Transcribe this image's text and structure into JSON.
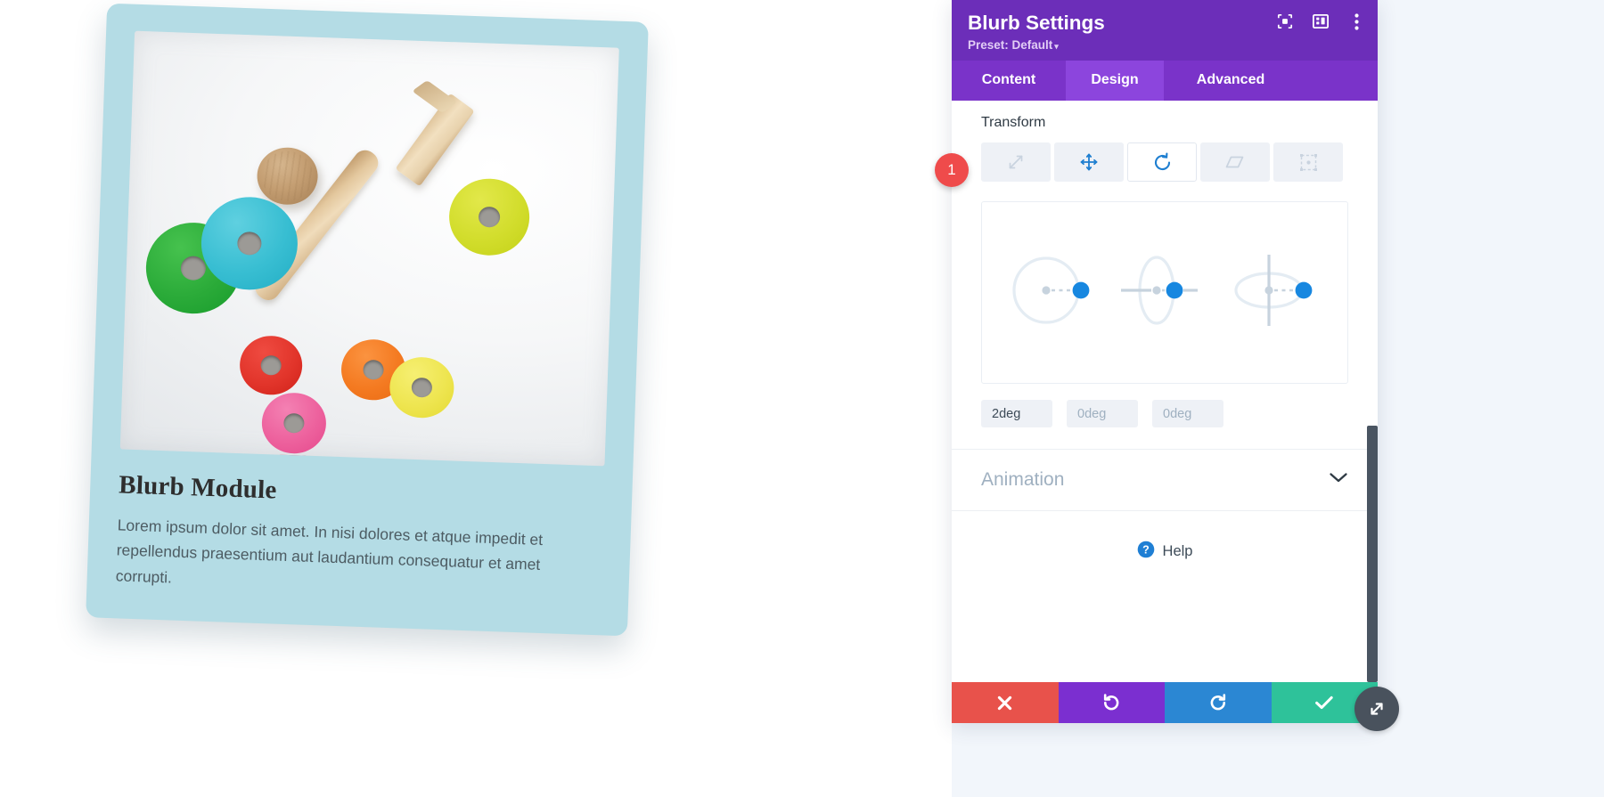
{
  "canvas": {
    "module": {
      "title": "Blurb Module",
      "description": "Lorem ipsum dolor sit amet. In nisi dolores et atque impedit et repellendus praesentium aut laudantium consequatur et amet corrupti.",
      "card_background": "#b4dce5",
      "rotation_applied": "2deg",
      "photo_alt": "wooden-toy-rings-and-mallet-photo"
    }
  },
  "panel": {
    "title": "Blurb Settings",
    "preset_label": "Preset: Default",
    "preset_caret": "▾",
    "header_icons": [
      {
        "name": "focus-icon",
        "label": "Focus"
      },
      {
        "name": "layout-icon",
        "label": "Layout"
      },
      {
        "name": "more-options-icon",
        "label": "More Options"
      }
    ],
    "brand_purple": "#6c2eb9",
    "tabs": [
      {
        "label": "Content",
        "active": false
      },
      {
        "label": "Design",
        "active": true
      },
      {
        "label": "Advanced",
        "active": false
      }
    ],
    "transform": {
      "section_label": "Transform",
      "tools": [
        {
          "name": "scale-tool",
          "label": "Scale",
          "active": false
        },
        {
          "name": "translate-tool",
          "label": "Move",
          "active": false
        },
        {
          "name": "rotate-tool",
          "label": "Rotate",
          "active": true
        },
        {
          "name": "skew-tool",
          "label": "Skew",
          "active": false
        },
        {
          "name": "origin-tool",
          "label": "Transform Origin",
          "active": false
        }
      ],
      "rotate_controls": [
        {
          "axis": "z",
          "name": "rotate-z-dial"
        },
        {
          "axis": "y",
          "name": "rotate-y-dial"
        },
        {
          "axis": "x",
          "name": "rotate-x-dial"
        }
      ],
      "degree_fields": [
        {
          "name": "rotate-z-input",
          "value": "2deg",
          "is_placeholder": false
        },
        {
          "name": "rotate-y-input",
          "value": "0deg",
          "is_placeholder": true
        },
        {
          "name": "rotate-x-input",
          "value": "0deg",
          "is_placeholder": true
        }
      ]
    },
    "animation": {
      "label": "Animation",
      "expanded": false
    },
    "help": {
      "label": "Help",
      "icon_color": "#2b87d3"
    },
    "actions": [
      {
        "name": "cancel-button",
        "glyph": "✖",
        "color": "#e8524b"
      },
      {
        "name": "undo-button",
        "glyph": "↺",
        "color": "#7b2fd0"
      },
      {
        "name": "redo-button",
        "glyph": "↻",
        "color": "#2b87d3"
      },
      {
        "name": "save-button",
        "glyph": "✔",
        "color": "#2ec29a"
      }
    ]
  },
  "annotations": {
    "step_badge": "1"
  }
}
